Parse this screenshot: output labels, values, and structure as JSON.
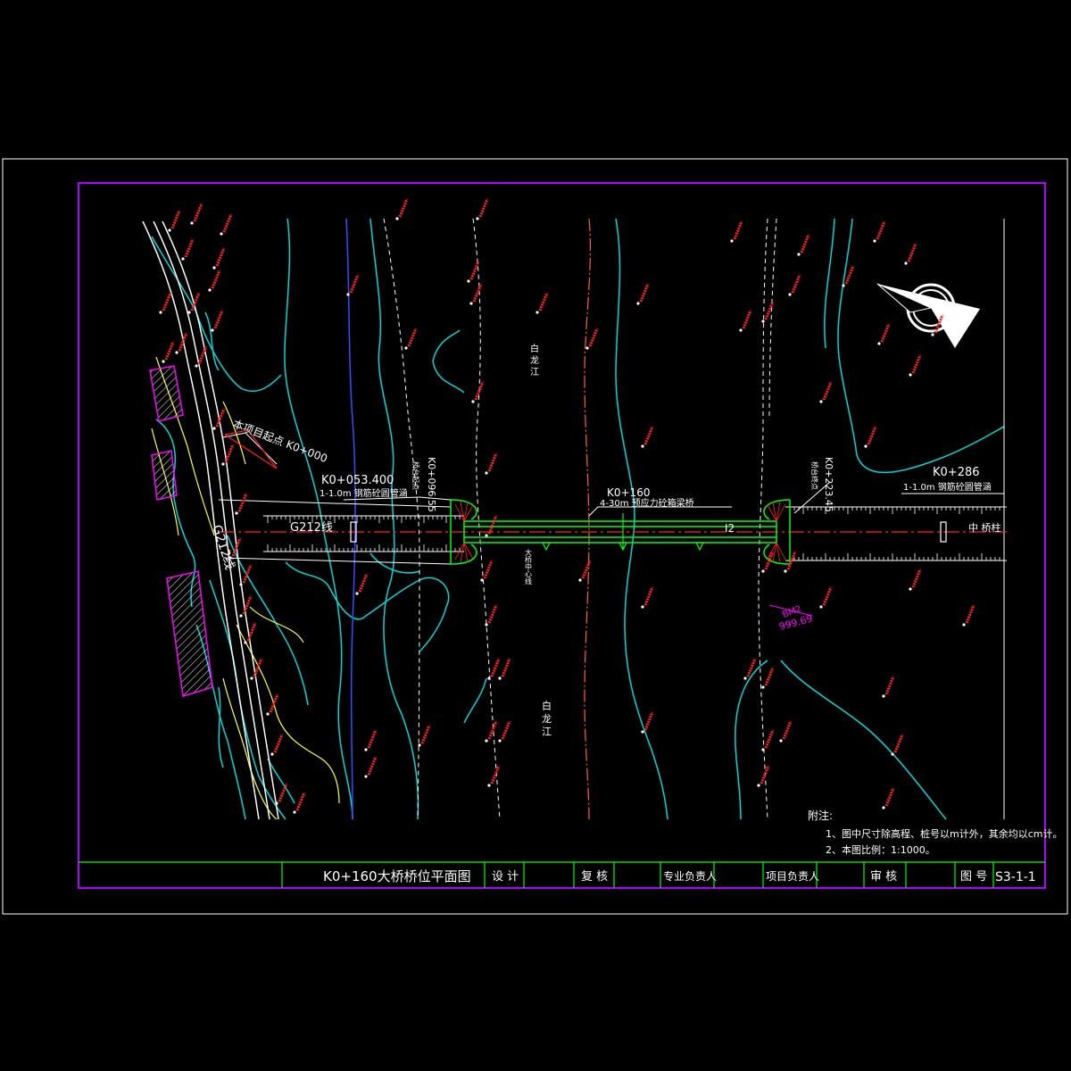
{
  "drawing": {
    "start_point_label": "本项目起点 K0+000",
    "culvert_left": {
      "station": "K0+053.400",
      "desc": "1-1.0m 钢筋砼圆管涵"
    },
    "culvert_right": {
      "station": "K0+286",
      "desc": "1-1.0m 钢筋砼圆管涵"
    },
    "abutment_left": {
      "station": "K0+096.55",
      "tag": "桥台起点"
    },
    "abutment_right": {
      "station": "K0+223.45",
      "tag": "桥台终点"
    },
    "bridge_center": {
      "station": "K0+160",
      "desc": "4-30m 预应力砼箱梁桥"
    },
    "road_label_main": "G212线",
    "road_label_side": "G212线",
    "pier_label": "I2",
    "right_end_label": "中 桥柱",
    "river_text_top": "白 龙 江",
    "river_text_bottom": "白 龙 江",
    "bridge_axis_label": "大桥中心线",
    "benchmark": {
      "id": "BM2",
      "elev": "999.69"
    }
  },
  "notes": {
    "title": "附注:",
    "line1": "1、图中尺寸除高程、桩号以m计外，其余均以cm计。",
    "line2": "2、本图比例：1:1000。"
  },
  "title_block": {
    "title": "K0+160大桥桥位平面图",
    "design": "设 计",
    "review": "复 核",
    "specialist": "专业负责人",
    "project_lead": "项目负责人",
    "approve": "审 核",
    "drawing_no_label": "图 号",
    "drawing_no": "S3-1-1"
  },
  "colors": {
    "frame": "#ffffff",
    "border": "#b000ff",
    "contour": "#00d8d8",
    "elevation_point": "#ff2020",
    "bridge": "#00ff00",
    "road": "#ffffff",
    "river": "#3050ff",
    "thalweg": "#ff6040",
    "yellow_line": "#ffff30",
    "hatch": "#ff00ff"
  }
}
